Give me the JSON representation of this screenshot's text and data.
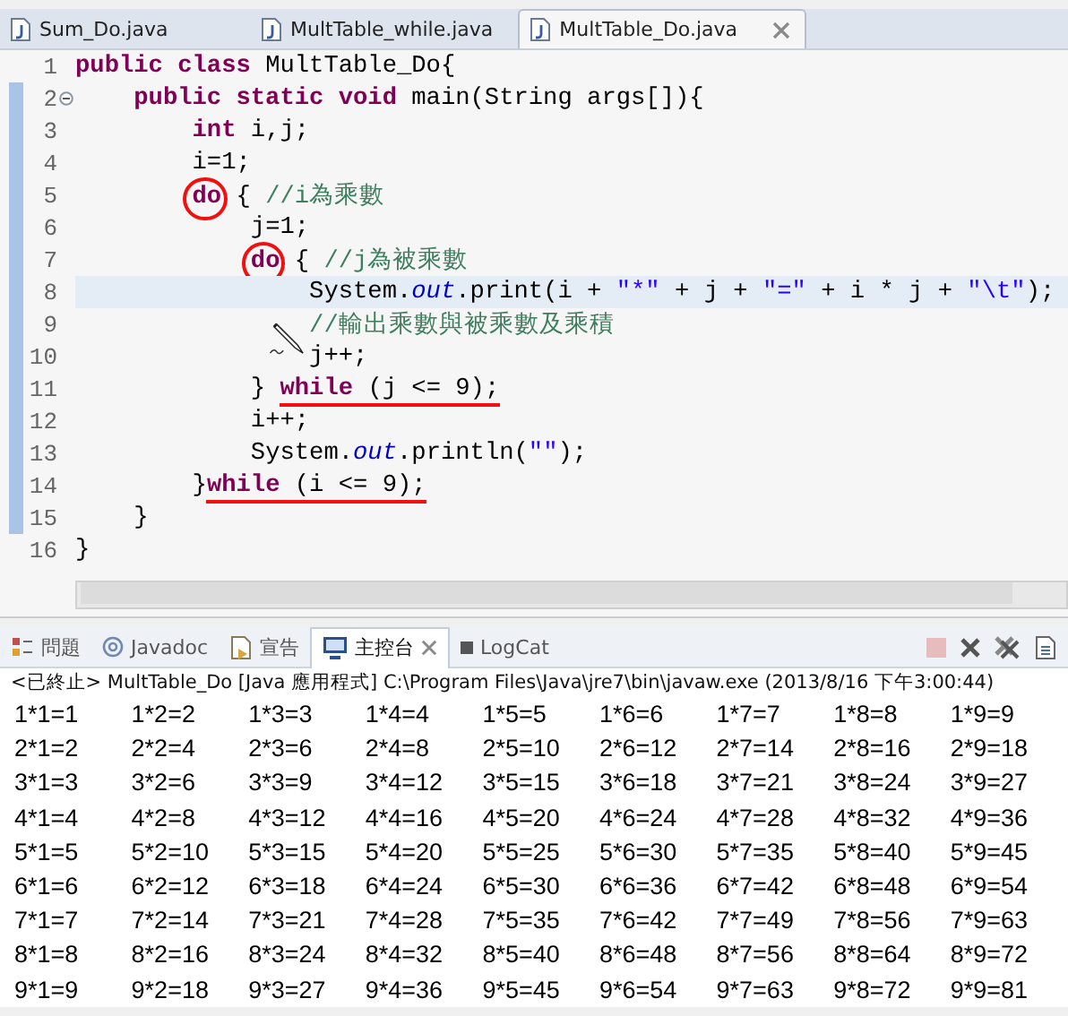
{
  "editor_tabs": [
    {
      "label": "Sum_Do.java",
      "selected": false,
      "closable": false
    },
    {
      "label": "MultTable_while.java",
      "selected": false,
      "closable": false
    },
    {
      "label": "MultTable_Do.java",
      "selected": true,
      "closable": true
    }
  ],
  "code_lines": [
    {
      "number": "1",
      "changed": false,
      "current": false,
      "fold": false,
      "tokens": [
        {
          "kind": "kw",
          "text": "public class"
        },
        {
          "kind": "plain",
          "text": " MultTable_Do{"
        }
      ]
    },
    {
      "number": "2",
      "changed": true,
      "current": false,
      "fold": true,
      "tokens": [
        {
          "kind": "kw",
          "text": "    public static void"
        },
        {
          "kind": "plain",
          "text": " main(String args[]){"
        }
      ]
    },
    {
      "number": "3",
      "changed": true,
      "current": false,
      "fold": false,
      "tokens": [
        {
          "kind": "kw",
          "text": "        int"
        },
        {
          "kind": "plain",
          "text": " i,j;"
        }
      ]
    },
    {
      "number": "4",
      "changed": true,
      "current": false,
      "fold": false,
      "tokens": [
        {
          "kind": "plain",
          "text": "        i=1;"
        }
      ]
    },
    {
      "number": "5",
      "changed": true,
      "current": false,
      "fold": false,
      "tokens": [
        {
          "kind": "kw",
          "text": "        do",
          "circled": true
        },
        {
          "kind": "plain",
          "text": " { ",
          "circled": false
        },
        {
          "kind": "comment",
          "text": "//i為乘數",
          "circled": false
        }
      ]
    },
    {
      "number": "6",
      "changed": true,
      "current": false,
      "fold": false,
      "tokens": [
        {
          "kind": "plain",
          "text": "            j=1;"
        }
      ]
    },
    {
      "number": "7",
      "changed": true,
      "current": false,
      "fold": false,
      "tokens": [
        {
          "kind": "kw",
          "text": "            do",
          "circled": true
        },
        {
          "kind": "plain",
          "text": " { ",
          "circled": false
        },
        {
          "kind": "comment",
          "text": "//j為被乘數",
          "circled": false
        }
      ]
    },
    {
      "number": "8",
      "changed": true,
      "current": true,
      "fold": false,
      "tokens": [
        {
          "kind": "plain",
          "text": "                System."
        },
        {
          "kind": "field",
          "text": "out"
        },
        {
          "kind": "plain",
          "text": ".print(i + "
        },
        {
          "kind": "string",
          "text": "\"*\""
        },
        {
          "kind": "plain",
          "text": " + j + "
        },
        {
          "kind": "string",
          "text": "\"=\""
        },
        {
          "kind": "plain",
          "text": " + i * j + "
        },
        {
          "kind": "string",
          "text": "\"\\t\""
        },
        {
          "kind": "plain",
          "text": ");"
        }
      ]
    },
    {
      "number": "9",
      "changed": true,
      "current": false,
      "fold": false,
      "tokens": [
        {
          "kind": "comment",
          "text": "                //輸出乘數與被乘數及乘積"
        }
      ]
    },
    {
      "number": "10",
      "changed": true,
      "current": false,
      "fold": false,
      "tokens": [
        {
          "kind": "plain",
          "text": "                j++;"
        }
      ]
    },
    {
      "number": "11",
      "changed": true,
      "current": false,
      "fold": false,
      "tokens": [
        {
          "kind": "plain",
          "text": "            } ",
          "underlined": false
        },
        {
          "kind": "kw",
          "text": "while",
          "underlined": true
        },
        {
          "kind": "plain",
          "text": " (j <= 9);",
          "underlined": true
        }
      ]
    },
    {
      "number": "12",
      "changed": true,
      "current": false,
      "fold": false,
      "tokens": [
        {
          "kind": "plain",
          "text": "            i++;"
        }
      ]
    },
    {
      "number": "13",
      "changed": true,
      "current": false,
      "fold": false,
      "tokens": [
        {
          "kind": "plain",
          "text": "            System."
        },
        {
          "kind": "field",
          "text": "out"
        },
        {
          "kind": "plain",
          "text": ".println("
        },
        {
          "kind": "string",
          "text": "\"\""
        },
        {
          "kind": "plain",
          "text": ");"
        }
      ]
    },
    {
      "number": "14",
      "changed": true,
      "current": false,
      "fold": false,
      "tokens": [
        {
          "kind": "plain",
          "text": "        }",
          "underlined": false
        },
        {
          "kind": "kw",
          "text": "while",
          "underlined": true
        },
        {
          "kind": "plain",
          "text": " (i <= 9);",
          "underlined": true
        }
      ]
    },
    {
      "number": "15",
      "changed": true,
      "current": false,
      "fold": false,
      "tokens": [
        {
          "kind": "plain",
          "text": "    }"
        }
      ]
    },
    {
      "number": "16",
      "changed": false,
      "current": false,
      "fold": false,
      "tokens": [
        {
          "kind": "plain",
          "text": "}"
        }
      ]
    }
  ],
  "view_tabs": [
    {
      "label": "問題",
      "kind": "problems",
      "selected": false
    },
    {
      "label": "Javadoc",
      "kind": "javadoc",
      "selected": false
    },
    {
      "label": "宣告",
      "kind": "declaration",
      "selected": false
    },
    {
      "label": "主控台",
      "kind": "console",
      "selected": true
    },
    {
      "label": "LogCat",
      "kind": "logcat",
      "selected": false
    }
  ],
  "console": {
    "header": "<已終止> MultTable_Do [Java 應用程式] C:\\Program Files\\Java\\jre7\\bin\\javaw.exe (2013/8/16 下午3:00:44)",
    "rows": [
      [
        "1*1=1",
        "1*2=2",
        "1*3=3",
        "1*4=4",
        "1*5=5",
        "1*6=6",
        "1*7=7",
        "1*8=8",
        "1*9=9"
      ],
      [
        "2*1=2",
        "2*2=4",
        "2*3=6",
        "2*4=8",
        "2*5=10",
        "2*6=12",
        "2*7=14",
        "2*8=16",
        "2*9=18"
      ],
      [
        "3*1=3",
        "3*2=6",
        "3*3=9",
        "3*4=12",
        "3*5=15",
        "3*6=18",
        "3*7=21",
        "3*8=24",
        "3*9=27"
      ],
      [
        "4*1=4",
        "4*2=8",
        "4*3=12",
        "4*4=16",
        "4*5=20",
        "4*6=24",
        "4*7=28",
        "4*8=32",
        "4*9=36"
      ],
      [
        "5*1=5",
        "5*2=10",
        "5*3=15",
        "5*4=20",
        "5*5=25",
        "5*6=30",
        "5*7=35",
        "5*8=40",
        "5*9=45"
      ],
      [
        "6*1=6",
        "6*2=12",
        "6*3=18",
        "6*4=24",
        "6*5=30",
        "6*6=36",
        "6*7=42",
        "6*8=48",
        "6*9=54"
      ],
      [
        "7*1=7",
        "7*2=14",
        "7*3=21",
        "7*4=28",
        "7*5=35",
        "7*6=42",
        "7*7=49",
        "7*8=56",
        "7*9=63"
      ],
      [
        "8*1=8",
        "8*2=16",
        "8*3=24",
        "8*4=32",
        "8*5=40",
        "8*6=48",
        "8*7=56",
        "8*8=64",
        "8*9=72"
      ],
      [
        "9*1=9",
        "9*2=18",
        "9*3=27",
        "9*4=36",
        "9*5=45",
        "9*6=54",
        "9*7=63",
        "9*8=72",
        "9*9=81"
      ]
    ]
  }
}
